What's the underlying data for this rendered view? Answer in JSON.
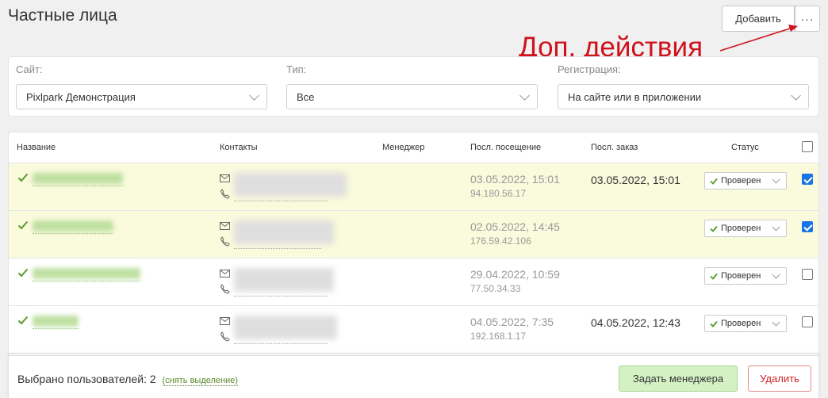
{
  "page": {
    "title": "Частные лица"
  },
  "toolbar": {
    "add_label": "Добавить",
    "more_label": "···"
  },
  "annotation": {
    "text": "Доп. действия",
    "color": "#d0111b"
  },
  "filters": {
    "site": {
      "label": "Сайт:",
      "value": "Pixlpark Демонстрация"
    },
    "type": {
      "label": "Тип:",
      "value": "Все"
    },
    "registration": {
      "label": "Регистрация:",
      "value": "На сайте или в приложении"
    }
  },
  "table": {
    "columns": {
      "name": "Название",
      "contacts": "Контакты",
      "manager": "Менеджер",
      "last_visit": "Посл. посещение",
      "last_order": "Посл. заказ",
      "status": "Статус"
    },
    "rows": [
      {
        "visit_date": "03.05.2022, 15:01",
        "visit_ip": "94.180.56.17",
        "last_order": "03.05.2022, 15:01",
        "status": "Проверен",
        "selected": true
      },
      {
        "visit_date": "02.05.2022, 14:45",
        "visit_ip": "176.59.42.106",
        "last_order": "",
        "status": "Проверен",
        "selected": true
      },
      {
        "visit_date": "29.04.2022, 10:59",
        "visit_ip": "77.50.34.33",
        "last_order": "",
        "status": "Проверен",
        "selected": false
      },
      {
        "visit_date": "04.05.2022, 7:35",
        "visit_ip": "192.168.1.17",
        "last_order": "04.05.2022, 12:43",
        "status": "Проверен",
        "selected": false
      }
    ]
  },
  "footer": {
    "selected_text": "Выбрано пользователей: 2",
    "deselect_label": "(снять выделение)",
    "assign_manager_label": "Задать менеджера",
    "delete_label": "Удалить"
  },
  "colors": {
    "accent_green": "#5a9a2a",
    "selected_row": "#fafadd",
    "checkbox_blue": "#1a73e8"
  }
}
